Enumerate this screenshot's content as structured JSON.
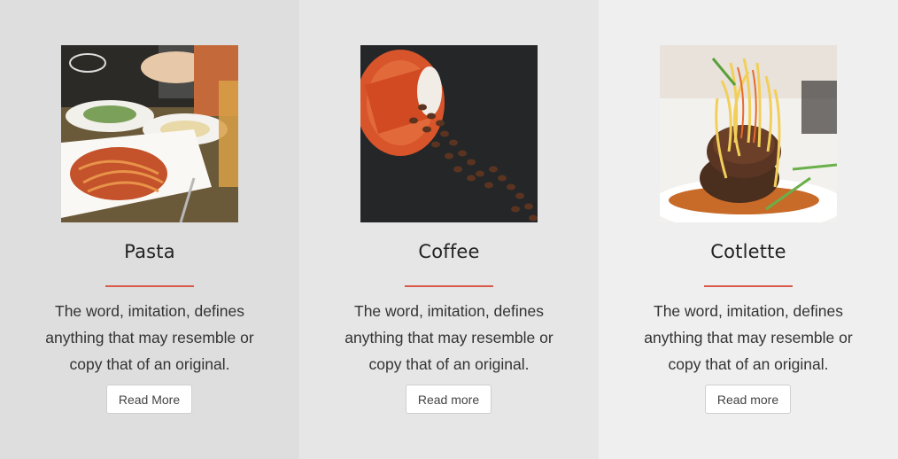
{
  "cards": [
    {
      "title": "Pasta",
      "description": "The word, imitation, defines anything that may resemble or copy that of an original.",
      "button_label": "Read More",
      "image": "pasta-dish-photo"
    },
    {
      "title": "Coffee",
      "description": "The word, imitation, defines anything that may resemble or copy that of an original.",
      "button_label": "Read more",
      "image": "coffee-beans-cup-photo"
    },
    {
      "title": "Cotlette",
      "description": "The word, imitation, defines anything that may resemble or copy that of an original.",
      "button_label": "Read more",
      "image": "cotlette-plated-dish-photo"
    }
  ],
  "colors": {
    "accent": "#d95a4a",
    "card_bg": [
      "#dedede",
      "#e6e6e6",
      "#efefef"
    ]
  }
}
